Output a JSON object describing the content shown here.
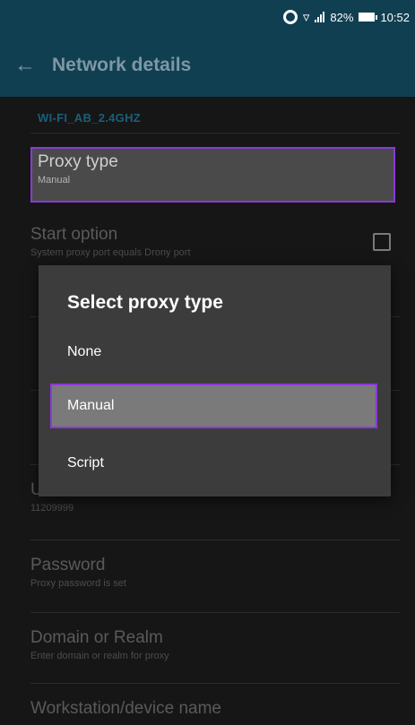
{
  "status_bar": {
    "battery": "82%",
    "time": "10:52"
  },
  "app_bar": {
    "title": "Network details"
  },
  "network": {
    "ssid": "WI-FI_AB_2.4GHZ"
  },
  "preferences": {
    "proxy_type": {
      "title": "Proxy type",
      "summary": "Manual"
    },
    "start_option": {
      "title": "Start option",
      "summary": "System proxy port equals Drony port"
    },
    "username": {
      "title": "Username",
      "summary": "11209999"
    },
    "password": {
      "title": "Password",
      "summary": "Proxy password is set"
    },
    "domain": {
      "title": "Domain or Realm",
      "summary": "Enter domain or realm for proxy"
    },
    "workstation": {
      "title": "Workstation/device name"
    }
  },
  "dialog": {
    "title": "Select proxy type",
    "options": [
      "None",
      "Manual",
      "Script"
    ],
    "selected": "Manual"
  },
  "colors": {
    "primary_dark": "#113f52",
    "accent_highlight": "#8a39d8",
    "dialog_bg": "#3c3c3c"
  }
}
